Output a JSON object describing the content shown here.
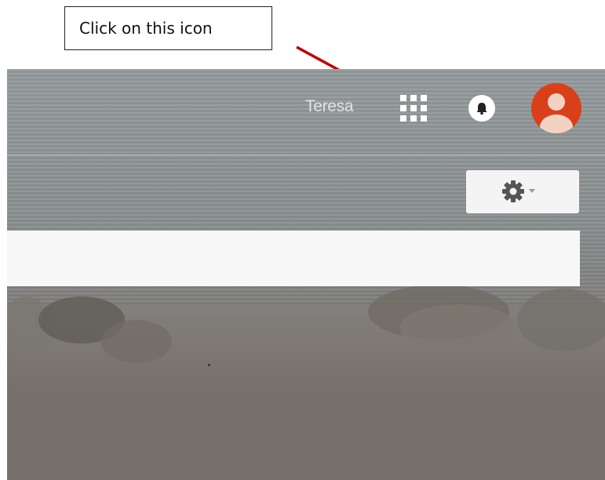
{
  "callout": {
    "text": "Click on this icon"
  },
  "header": {
    "username": "Teresa"
  },
  "icons": {
    "apps": "apps-grid-icon",
    "notifications": "bell-icon",
    "account": "avatar-icon",
    "settings": "gear-icon",
    "settings_dropdown": "caret-down-icon"
  },
  "colors": {
    "avatar_bg": "#d9401a",
    "arrow": "#c00000"
  }
}
